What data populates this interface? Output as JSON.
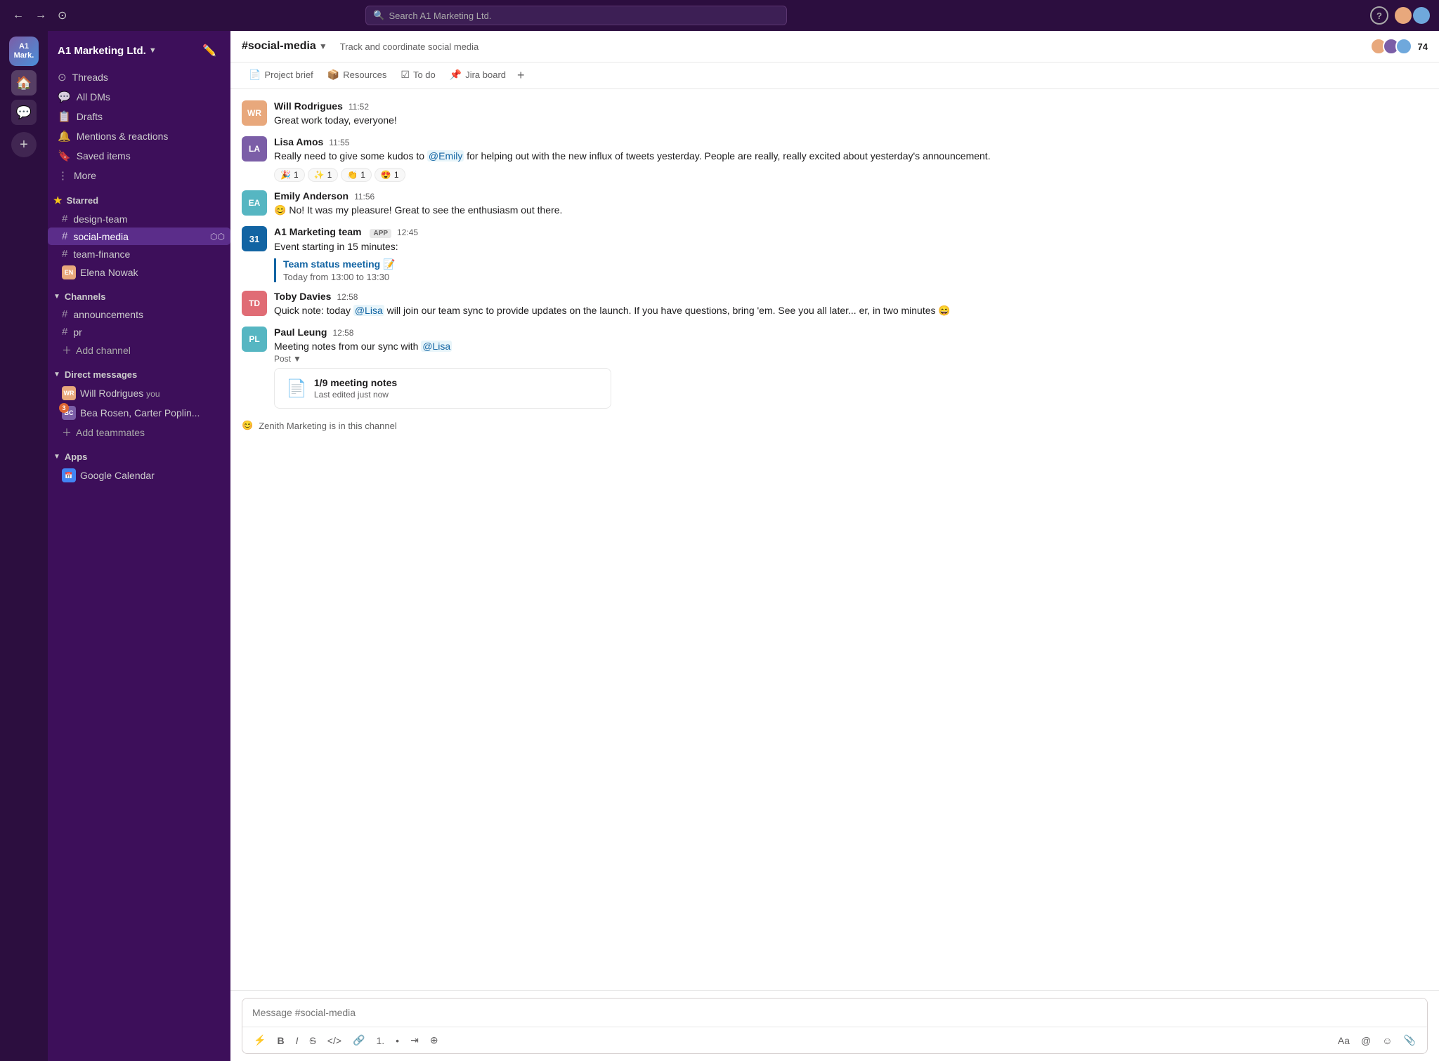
{
  "topbar": {
    "search_placeholder": "Search A1 Marketing Ltd.",
    "help_label": "?",
    "back_label": "←",
    "forward_label": "→",
    "history_label": "⊙"
  },
  "workspace": {
    "name": "A1 Marketing Ltd.",
    "short": "A1\nMark."
  },
  "sidebar": {
    "nav_items": [
      {
        "id": "threads",
        "icon": "⊙",
        "label": "Threads"
      },
      {
        "id": "all-dms",
        "icon": "💬",
        "label": "All DMs"
      },
      {
        "id": "drafts",
        "icon": "📋",
        "label": "Drafts"
      },
      {
        "id": "mentions",
        "icon": "🔔",
        "label": "Mentions & reactions"
      },
      {
        "id": "saved",
        "icon": "🔖",
        "label": "Saved items"
      },
      {
        "id": "more",
        "icon": "⋮",
        "label": "More"
      }
    ],
    "starred_channels": [
      {
        "id": "design-team",
        "name": "design-team"
      },
      {
        "id": "social-media",
        "name": "social-media",
        "active": true
      },
      {
        "id": "team-finance",
        "name": "team-finance"
      }
    ],
    "starred_dms": [
      {
        "id": "elena",
        "name": "Elena Nowak",
        "initials": "EN",
        "color": "#e8a87c"
      }
    ],
    "channels": [
      {
        "id": "announcements",
        "name": "announcements"
      },
      {
        "id": "pr",
        "name": "pr"
      }
    ],
    "add_channel": "Add channel",
    "direct_messages": [
      {
        "id": "will",
        "name": "Will Rodrigues",
        "extra": "you",
        "initials": "WR",
        "color": "#e8a87c"
      },
      {
        "id": "bea-carter",
        "name": "Bea Rosen, Carter Poplin...",
        "initials": "BC",
        "color": "#7B5EA7",
        "badge": "3"
      }
    ],
    "add_teammates": "Add teammates",
    "apps": [
      {
        "id": "google-calendar",
        "name": "Google Calendar"
      }
    ],
    "add_channel_label": "Add channel",
    "sections": {
      "channels": "Channels",
      "direct_messages": "Direct messages",
      "apps": "Apps"
    }
  },
  "channel": {
    "name": "#social-media",
    "description": "Track and coordinate social media",
    "member_count": "74",
    "tabs": [
      {
        "id": "project-brief",
        "icon": "📄",
        "label": "Project brief"
      },
      {
        "id": "resources",
        "icon": "📦",
        "label": "Resources"
      },
      {
        "id": "to-do",
        "icon": "☑",
        "label": "To do"
      },
      {
        "id": "jira-board",
        "icon": "📌",
        "label": "Jira board"
      }
    ],
    "tab_add": "+"
  },
  "messages": [
    {
      "id": "msg1",
      "author": "Will Rodrigues",
      "time": "11:52",
      "text": "Great work today, everyone!",
      "avatar_class": "av2",
      "initials": "WR"
    },
    {
      "id": "msg2",
      "author": "Lisa Amos",
      "time": "11:55",
      "text_pre": "Really need to give some kudos to ",
      "mention": "@Emily",
      "text_post": " for helping out with the new influx of tweets yesterday. People are really, really excited about yesterday's announcement.",
      "avatar_class": "av1",
      "initials": "LA",
      "reactions": [
        {
          "emoji": "🎉",
          "count": "1"
        },
        {
          "emoji": "✨",
          "count": "1"
        },
        {
          "emoji": "👏",
          "count": "1"
        },
        {
          "emoji": "😍",
          "count": "1"
        }
      ]
    },
    {
      "id": "msg3",
      "author": "Emily Anderson",
      "time": "11:56",
      "text": "No! It was my pleasure! Great to see the enthusiasm out there.",
      "avatar_class": "av3",
      "initials": "EA",
      "emoji_prefix": "😊"
    },
    {
      "id": "msg4",
      "author": "A1 Marketing team",
      "time": "12:45",
      "is_app": true,
      "app_badge": "APP",
      "text": "Event starting in 15 minutes:",
      "event_title": "Team status meeting 📝",
      "event_time": "Today from 13:00 to 13:30",
      "avatar_label": "31"
    },
    {
      "id": "msg5",
      "author": "Toby Davies",
      "time": "12:58",
      "text_pre": "Quick note: today ",
      "mention": "@Lisa",
      "text_post": " will join our team sync to provide updates on the launch. If you have questions, bring 'em. See you all later... er, in two minutes 😄",
      "avatar_class": "av5",
      "initials": "TD"
    },
    {
      "id": "msg6",
      "author": "Paul Leung",
      "time": "12:58",
      "text_pre": "Meeting notes from our sync with ",
      "mention": "@Lisa",
      "text_post": "",
      "avatar_class": "av6",
      "initials": "PL",
      "post_label": "Post",
      "post_title": "1/9 meeting notes",
      "post_sub": "Last edited just now"
    }
  ],
  "zenith": {
    "icon": "😊",
    "text": "Zenith Marketing is in this channel"
  },
  "input": {
    "placeholder": "Message #social-media"
  },
  "toolbar": {
    "lightning": "⚡",
    "bold": "B",
    "italic": "I",
    "strike": "S",
    "code": "</>",
    "link": "🔗",
    "ol": "1.",
    "ul": "•",
    "indent": "⇥",
    "attach": "⊕",
    "text_format": "Aa",
    "mention": "@",
    "emoji": "☺",
    "attach_file": "📎"
  }
}
